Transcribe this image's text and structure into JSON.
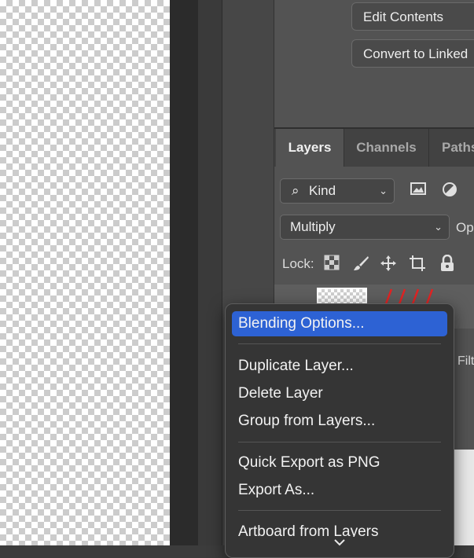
{
  "properties": {
    "edit_contents": "Edit Contents",
    "convert_linked": "Convert to Linked"
  },
  "tabs": {
    "layers": "Layers",
    "channels": "Channels",
    "paths": "Paths"
  },
  "filter": {
    "kind_label": "Kind"
  },
  "blend_mode": {
    "value": "Multiply",
    "opacity_label": "Op"
  },
  "lock": {
    "label": "Lock:"
  },
  "filter_side_label": "Filt",
  "context_menu": {
    "items": [
      "Blending Options...",
      "Duplicate Layer...",
      "Delete Layer",
      "Group from Layers...",
      "Quick Export as PNG",
      "Export As...",
      "Artboard from Layers"
    ],
    "selected_index": 0
  },
  "colors": {
    "menu_highlight": "#2d62d4",
    "panel_bg": "#535353",
    "stroke_red": "#e02424"
  }
}
